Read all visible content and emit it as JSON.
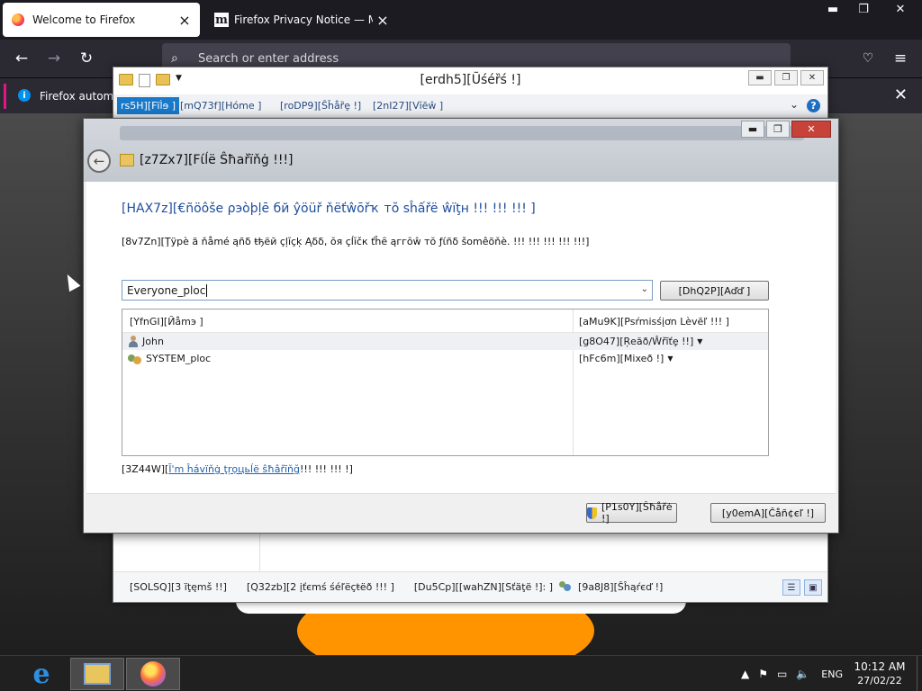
{
  "firefox": {
    "tabs": [
      {
        "label": "Welcome to Firefox",
        "active": true
      },
      {
        "label": "Firefox Privacy Notice — Mozilla",
        "active": false
      }
    ],
    "window_controls": {
      "minimize": "▬",
      "restore": "❐",
      "close": "✕"
    },
    "urlbar": {
      "placeholder": "Search or enter address"
    },
    "notification": {
      "text": "Firefox automat"
    },
    "icons": {
      "back": "arrow-left-icon",
      "forward": "arrow-right-icon",
      "reload": "reload-icon",
      "pocket": "pocket-icon",
      "menu": "hamburger-icon"
    }
  },
  "explorer": {
    "title": "[erdh5][Ũśéȑś !]",
    "ribbon_tabs": [
      "rs5H][Fïl̀ɘ ]",
      "[mQ73f][Hóme ]",
      "[roDP9][Ŝȟåȑȩ !]",
      "[2nI27][Vĭēŵ ]"
    ],
    "status": {
      "items": "[SOLSQ][3 ïţęmš !!]",
      "selected": "[Q32zb][2 įťєmś śéľёçŧёð !!! ]",
      "state_prefix": "[Du5Cp][[wahZN][Sťäţë !]: ]",
      "shared": "[9a8J8][Ŝĥąŕєď !]"
    }
  },
  "dialog": {
    "title": "[z7Zx7][Fίĺë Ŝħаřïňġ !!!]",
    "heading": "[HAX7z][€ñöôšе ρэòþļē бй ŷöüř ňёťŵōřҡ тŏ ѕĥấřë ŵïţн !!! !!! !!! ]",
    "instruction": "[8v7Zn][Ţÿрè ä ňåmé ąñδ ŧђёй çļĭçķ Ąδδ, ŏя çĺĭčк ťĥȇ ąггŏŵ тŏ ƒίñδ šomêõňè. !!! !!! !!! !!! !!!]",
    "input_value": "Everyone_ploc",
    "add_button": "[DhQ2P][Aďď ]",
    "columns": {
      "name": "[YfnGI][Йåmэ ]",
      "permission": "[aMu9K][Psŕmisśįơn Lèvēľ !!! ]"
    },
    "rows": [
      {
        "name": "John",
        "permission": "[g8O47][Ŗeăð/Ŵřīťȩ !!]",
        "selected": true
      },
      {
        "name": "SYSTEM_ploc",
        "permission": "[hFc6m][Mixeð !]",
        "selected": false
      }
    ],
    "help_prefix": "[3Z44W][",
    "help_link": "Ĩ'm ĥávïňġ ţŗọцьĺё ŝħâřīňğ",
    "help_suffix": " !!! !!! !!! !]",
    "share_button": "[P1s0Y][Ŝħåřė !]",
    "cancel_button": "[y0emA][Ĉåñ¢єľ !]"
  },
  "taskbar": {
    "pinned": [
      "internet-explorer-icon",
      "file-explorer-icon",
      "firefox-icon"
    ],
    "language": "ENG",
    "time": "10:12 AM",
    "date": "27/02/22"
  },
  "colors": {
    "firefox_dark": "#1c1b22",
    "dialog_heading": "#1e4e9c",
    "link": "#1e5fae",
    "taskbar": "#202020"
  }
}
